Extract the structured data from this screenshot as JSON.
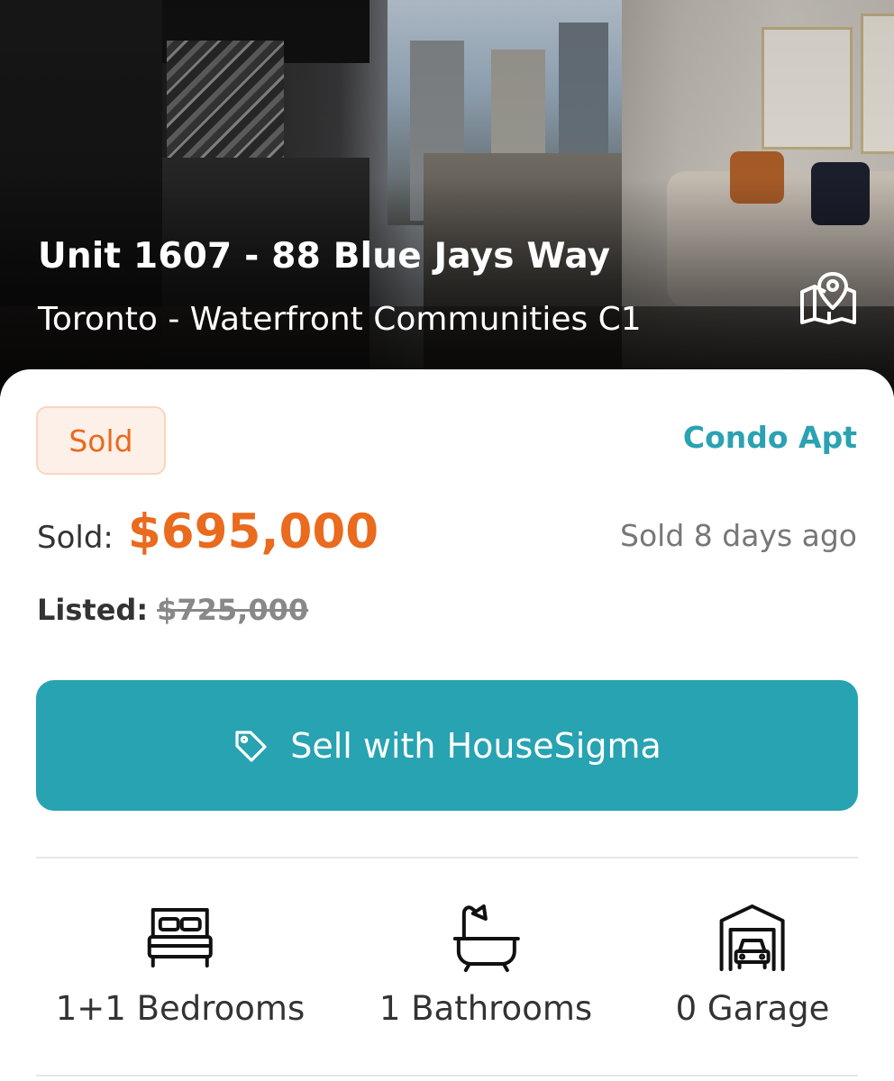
{
  "hero": {
    "title": "Unit 1607 - 88 Blue Jays Way",
    "subtitle": "Toronto - Waterfront Communities C1",
    "map_icon": "map-pin-icon"
  },
  "listing": {
    "status": "Sold",
    "property_type": "Condo Apt",
    "sold_label": "Sold:",
    "sold_price": "$695,000",
    "sold_ago": "Sold 8 days ago",
    "listed_label": "Listed:",
    "listed_price": "$725,000"
  },
  "actions": {
    "sell_button_label": "Sell with HouseSigma",
    "sell_button_icon": "tag-icon"
  },
  "features": [
    {
      "icon": "bed-icon",
      "label": "1+1 Bedrooms"
    },
    {
      "icon": "bathtub-icon",
      "label": "1 Bathrooms"
    },
    {
      "icon": "garage-icon",
      "label": "0 Garage"
    }
  ],
  "colors": {
    "accent_teal": "#27a3b2",
    "sold_orange": "#ea6a1e",
    "badge_bg": "#fdf0e8"
  }
}
